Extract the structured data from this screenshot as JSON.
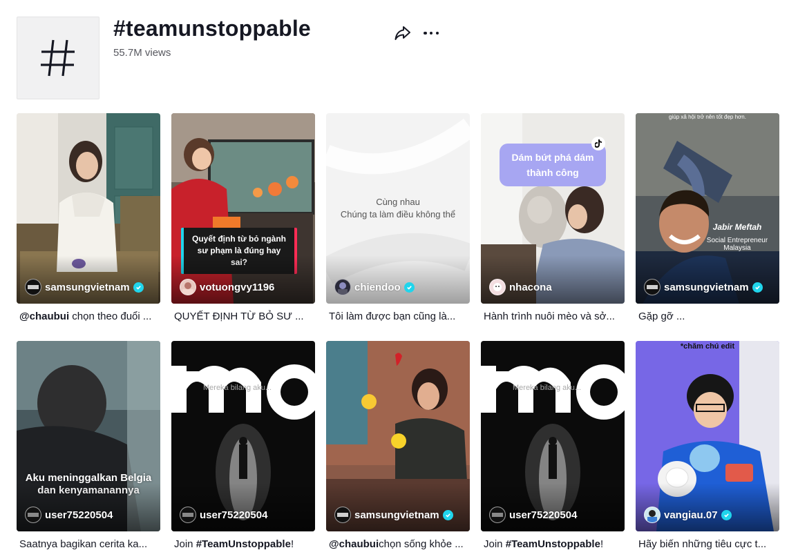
{
  "hashtag": {
    "title": "#teamunstoppable",
    "views": "55.7M views",
    "icon": "hashtag-icon",
    "actions": {
      "share_icon": "share-icon",
      "more_icon": "more-options-icon"
    }
  },
  "videos": [
    {
      "owner": "samsungvietnam",
      "verified": true,
      "caption_bold": "@chaubui",
      "caption": " chọn theo đuổi ..."
    },
    {
      "owner": "votuongvy1196",
      "verified": false,
      "caption_bold": "",
      "caption": "QUYẾT ĐỊNH TỪ BỎ SƯ ...",
      "overlay": "Quyết định từ bỏ ngành sư phạm là đúng hay sai?"
    },
    {
      "owner": "chiendoo",
      "verified": true,
      "caption_bold": "",
      "caption": "Tôi làm được bạn cũng là...",
      "overlay_line1": "Cùng nhau",
      "overlay_line2": "Chúng ta làm điều không thể"
    },
    {
      "owner": "nhacona",
      "verified": false,
      "caption_bold": "",
      "caption": "Hành trình nuôi mèo và sở...",
      "overlay": "Dám bứt phá dám thành công"
    },
    {
      "owner": "samsungvietnam",
      "verified": true,
      "caption_bold": "",
      "caption": "Gặp gỡ ...",
      "overlay_top": "giúp xã hội trở nên tốt đẹp hơn.",
      "overlay_name": "Jabir Meftah",
      "overlay_role": "Social Entrepreneur",
      "overlay_country": "Malaysia"
    },
    {
      "owner": "user75220504",
      "verified": false,
      "caption_bold": "",
      "caption": "Saatnya bagikan cerita ka...",
      "overlay": "Aku meninggalkan Belgia dan kenyamanannya"
    },
    {
      "owner": "user75220504",
      "verified": false,
      "caption_pre": "Join ",
      "caption_bold": "#TeamUnstoppable",
      "caption": "!",
      "overlay": "Mereka bilang aku..."
    },
    {
      "owner": "samsungvietnam",
      "verified": true,
      "caption_bold": "@chaubui",
      "caption": "chọn sống khỏe ..."
    },
    {
      "owner": "user75220504",
      "verified": false,
      "caption_pre": "Join ",
      "caption_bold": "#TeamUnstoppable",
      "caption": "!",
      "overlay": "Mereka bilang aku..."
    },
    {
      "owner": "vangiau.07",
      "verified": true,
      "caption_bold": "",
      "caption": "Hãy biến những tiêu cực t...",
      "overlay": "*chăm chú edit"
    }
  ],
  "colors": {
    "verified": "#20d5ec",
    "text": "#161823",
    "muted": "#57585f"
  }
}
